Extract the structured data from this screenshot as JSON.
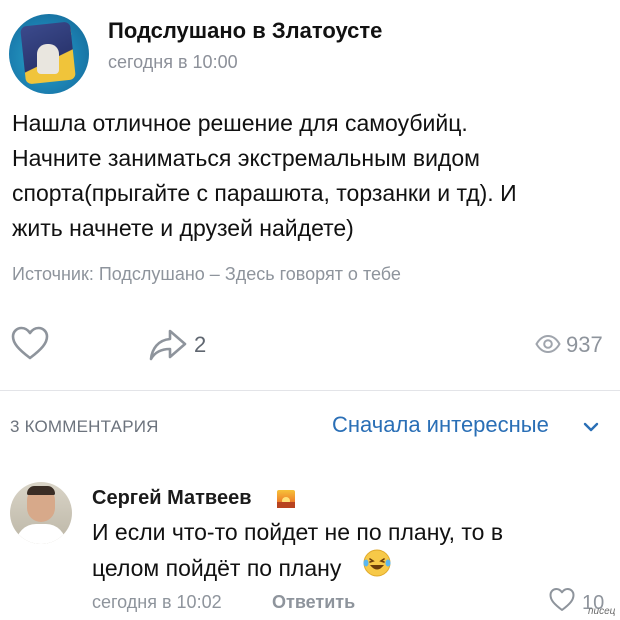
{
  "post": {
    "group_name": "Подслушано в Златоусте",
    "time": "сегодня в 10:00",
    "text": "Нашла отличное решение для самоубийц.\nНачните заниматься экстремальным видом\nспорта(прыгайте с парашюта, торзанки и тд). И\nжить начнете и друзей найдете)",
    "source": "Источник: Подслушано – Здесь говорят о тебе",
    "shares": "2",
    "views": "937",
    "icons": {
      "like": "heart-icon",
      "share": "share-arrow-icon",
      "views": "eye-icon"
    }
  },
  "comments_header": {
    "count_label": "3 КОММЕНТАРИЯ",
    "sort_label": "Сначала интересные",
    "sort_icon": "chevron-down-icon"
  },
  "comment": {
    "author": "Сергей Матвеев",
    "text": "И если что-то пойдет не по плану, то в\nцелом пойдёт по плану",
    "time": "сегодня в 10:02",
    "reply_label": "Ответить",
    "likes": "10",
    "icons": {
      "badge": "sunset-emoji-icon",
      "laugh": "laughing-emoji-icon",
      "like": "heart-outline-icon"
    }
  },
  "watermark": "писец",
  "colors": {
    "link": "#2a6fb6",
    "secondary": "#8e949c",
    "divider": "#e3e4e8"
  }
}
